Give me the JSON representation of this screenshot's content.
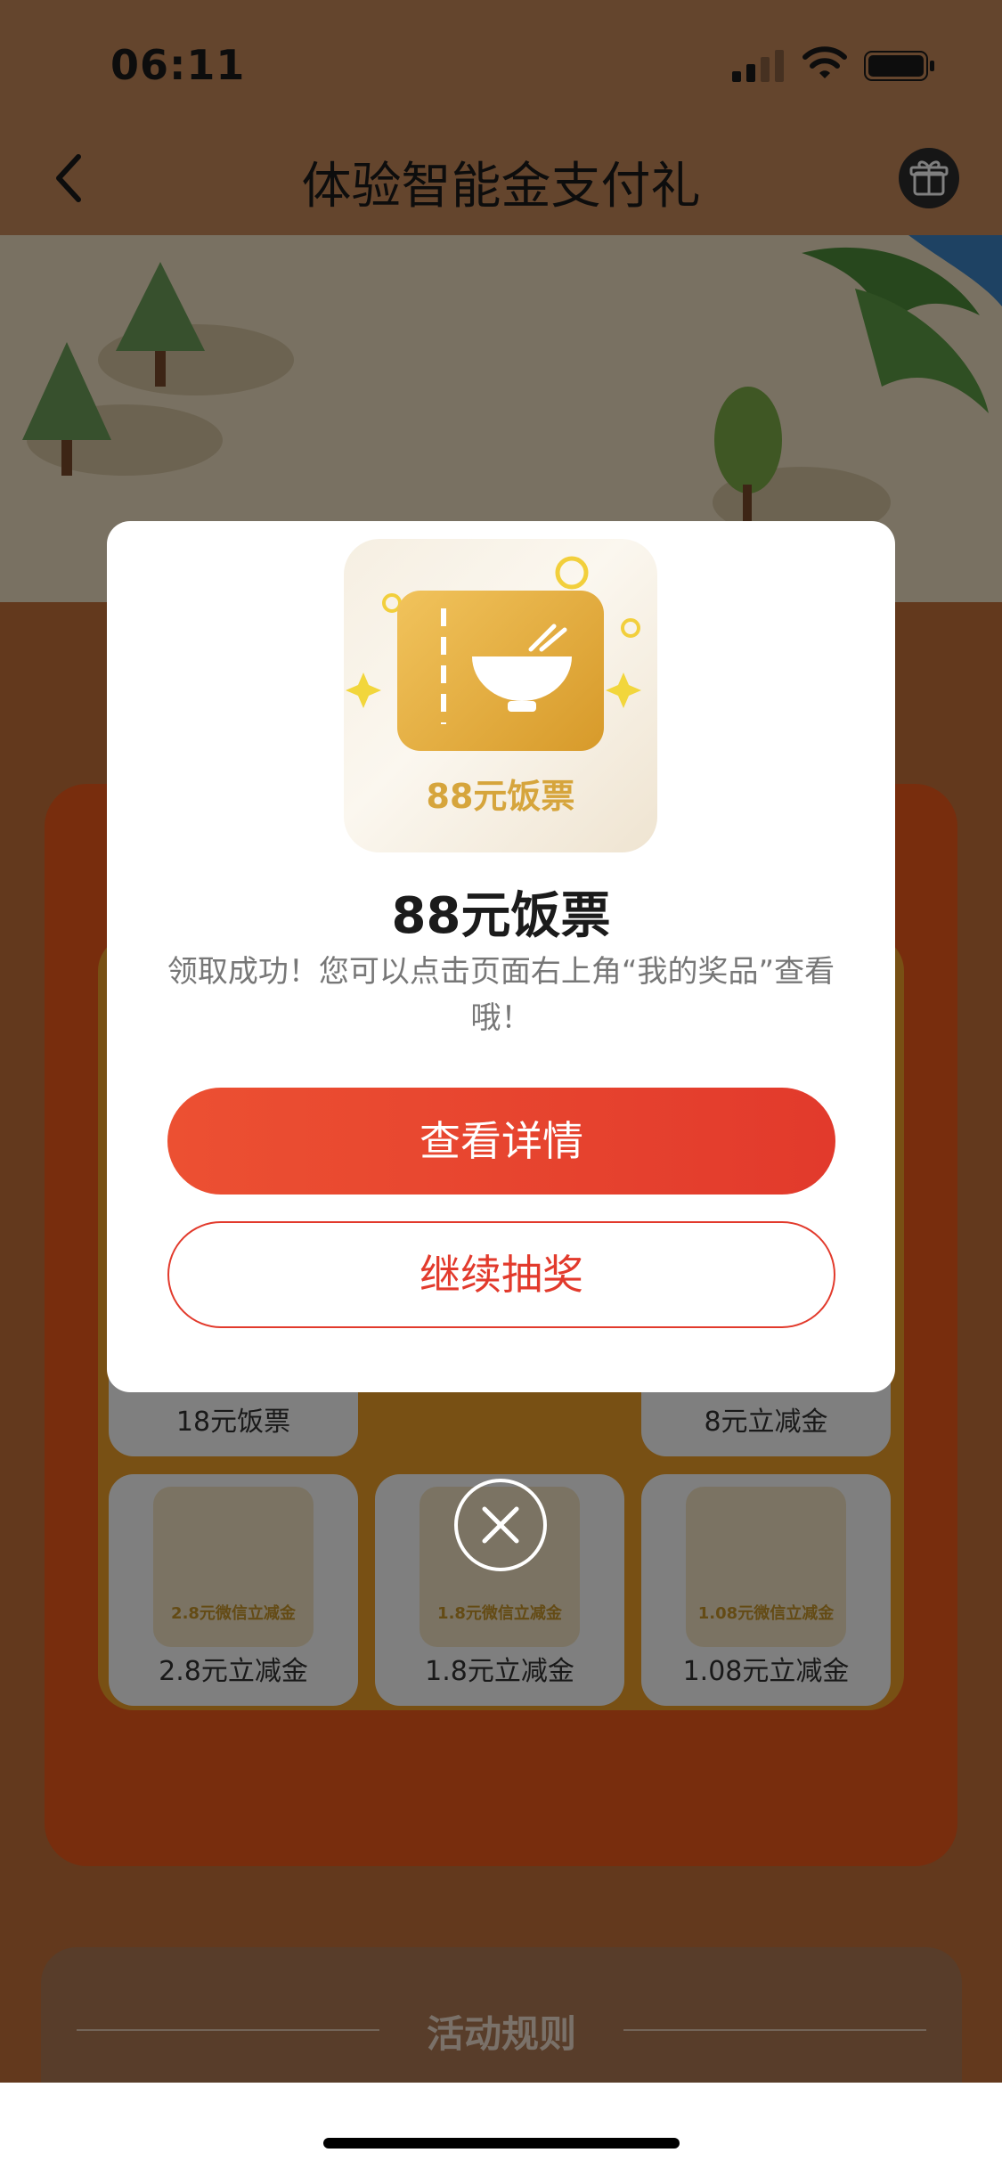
{
  "status_bar": {
    "time": "06:11"
  },
  "nav": {
    "title": "体验智能金支付礼",
    "back_icon": "chevron-left-icon",
    "gift_icon": "gift-icon"
  },
  "grid": {
    "cells": [
      {
        "label": "18元饭票",
        "caption": ""
      },
      {
        "label": "8元立减金",
        "caption": ""
      },
      {
        "label": "2.8元立减金",
        "caption": "2.8元微信立减金"
      },
      {
        "label": "1.8元立减金",
        "caption": "1.8元微信立减金"
      },
      {
        "label": "1.08元立减金",
        "caption": "1.08元微信立减金"
      }
    ]
  },
  "rules": {
    "title": "活动规则"
  },
  "modal": {
    "image_caption": "88元饭票",
    "prize_name": "88元饭票",
    "description": "领取成功！您可以点击页面右上角“我的奖品”查看哦！",
    "primary_button": "查看详情",
    "secondary_button": "继续抽奖",
    "close_icon": "close-icon"
  },
  "colors": {
    "accent_red": "#e23a2c",
    "gold": "#d6a53c"
  }
}
